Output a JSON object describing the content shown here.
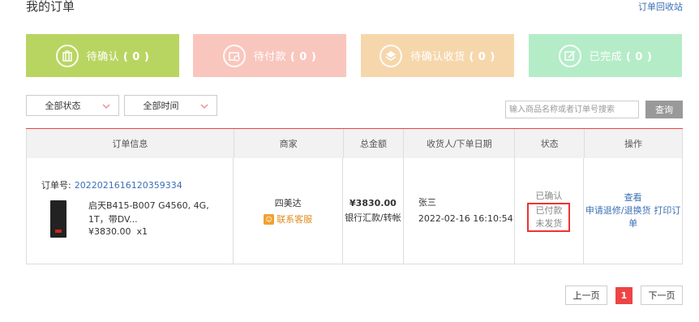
{
  "header": {
    "title": "我的订单",
    "recycle_link": "订单回收站"
  },
  "stats": [
    {
      "label": "待确认",
      "count": "( 0 )",
      "color": "#b9d561",
      "icon": "luggage-icon"
    },
    {
      "label": "待付款",
      "count": "( 0 )",
      "color": "#f9c6bd",
      "icon": "wallet-icon"
    },
    {
      "label": "待确认收货",
      "count": "( 0 )",
      "color": "#f6d7ac",
      "icon": "layers-icon"
    },
    {
      "label": "已完成",
      "count": "( 0 )",
      "color": "#b5ecc8",
      "icon": "edit-icon"
    }
  ],
  "filters": {
    "status": "全部状态",
    "time": "全部时间"
  },
  "search": {
    "placeholder": "输入商品名称或者订单号搜索",
    "button": "查询"
  },
  "table": {
    "headers": [
      "订单信息",
      "商家",
      "总金额",
      "收货人/下单日期",
      "状态",
      "操作"
    ],
    "order": {
      "order_no_label": "订单号:",
      "order_no": "2022021616120359334",
      "product_name": "启天B415-B007 G4560, 4G, 1T，带DV...",
      "product_price": "¥3830.00",
      "product_qty": "x1",
      "shop": "四美达",
      "contact": "联系客服",
      "total": "¥3830.00",
      "pay_method": "银行汇款/转帐",
      "receiver": "张三",
      "order_date": "2022-02-16 16:10:54",
      "status_confirmed": "已确认",
      "status_paid": "已付款",
      "status_shipping": "未发货",
      "op_view": "查看",
      "op_return": "申请退修/退换货",
      "op_print": "打印订单"
    }
  },
  "pager": {
    "prev": "上一页",
    "current": "1",
    "next": "下一页"
  }
}
